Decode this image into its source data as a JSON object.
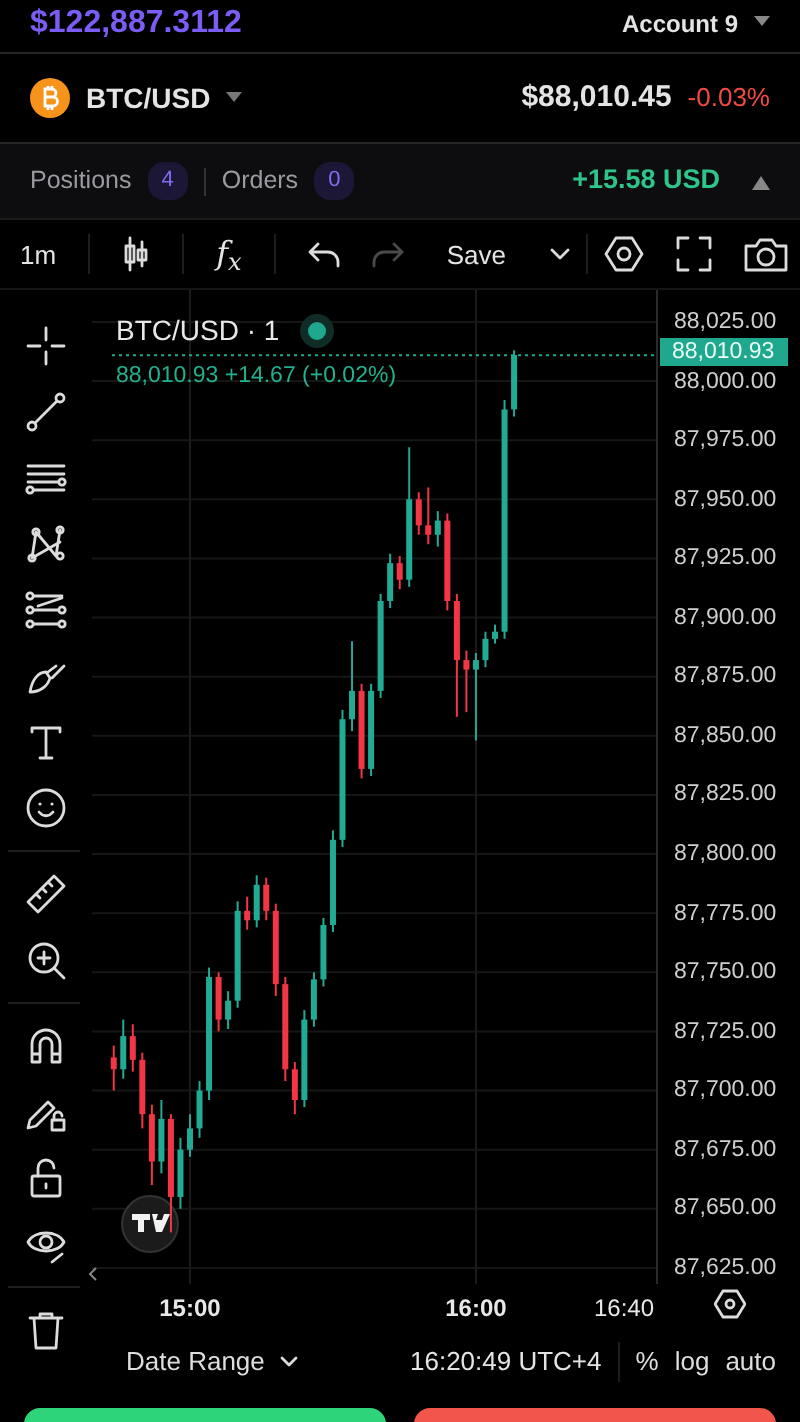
{
  "header": {
    "balance": "$122,887.3112",
    "account": "Account 9"
  },
  "ticker": {
    "symbol": "BTC/USD",
    "price": "$88,010.45",
    "change": "-0.03%"
  },
  "tabs": [
    {
      "label": "Positions",
      "count": "4"
    },
    {
      "label": "Orders",
      "count": "0"
    }
  ],
  "pnl": "+15.58 USD",
  "toolbar": {
    "interval": "1m",
    "indicators": "f$_{x}$",
    "save": "Save"
  },
  "tool_groups": [
    [
      {
        "kind": "crosshair"
      },
      {
        "kind": "trend-line"
      },
      {
        "kind": "horizontal-lines"
      },
      {
        "kind": "pattern"
      },
      {
        "kind": "channel"
      },
      {
        "kind": "brush"
      },
      {
        "kind": "text"
      },
      {
        "kind": "emoji"
      }
    ],
    [
      {
        "kind": "ruler"
      },
      {
        "kind": "zoom-in"
      }
    ],
    [
      {
        "kind": "magnet"
      },
      {
        "kind": "pencil-lock"
      },
      {
        "kind": "lock-open"
      },
      {
        "kind": "eye"
      }
    ],
    [
      {
        "kind": "trash"
      }
    ]
  ],
  "chart": {
    "chart_data": {
      "type": "candlestick",
      "xlim": [
        879.44,
        997.78
      ],
      "ylim": [
        87618.2,
        88038.5
      ],
      "grid": true,
      "ref_lines": [
        {
          "axis": "y",
          "value": 88010.93,
          "color": "#1fa88e"
        }
      ],
      "xticks": [
        {
          "value": 900,
          "label": "15:00"
        },
        {
          "value": 960,
          "label": "16:00"
        }
      ],
      "yticks": [
        {
          "value": 88025,
          "label": "88,025.00"
        },
        {
          "value": 88000,
          "label": "88,000.00"
        },
        {
          "value": 87975,
          "label": "87,975.00"
        },
        {
          "value": 87950,
          "label": "87,950.00"
        },
        {
          "value": 87925,
          "label": "87,925.00"
        },
        {
          "value": 87900,
          "label": "87,900.00"
        },
        {
          "value": 87875,
          "label": "87,875.00"
        },
        {
          "value": 87850,
          "label": "87,850.00"
        },
        {
          "value": 87825,
          "label": "87,825.00"
        },
        {
          "value": 87800,
          "label": "87,800.00"
        },
        {
          "value": 87775,
          "label": "87,775.00"
        },
        {
          "value": 87750,
          "label": "87,750.00"
        },
        {
          "value": 87725,
          "label": "87,725.00"
        },
        {
          "value": 87700,
          "label": "87,700.00"
        },
        {
          "value": 87675,
          "label": "87,675.00"
        },
        {
          "value": 87650,
          "label": "87,650.00"
        },
        {
          "value": 87625,
          "label": "87,625.00"
        }
      ],
      "x": [
        884,
        886,
        888,
        890,
        892,
        894,
        896,
        898,
        900,
        902,
        904,
        906,
        908,
        910,
        912,
        914,
        916,
        918,
        920,
        922,
        924,
        926,
        928,
        930,
        932,
        934,
        936,
        938,
        940,
        942,
        944,
        946,
        948,
        950,
        952,
        954,
        956,
        958,
        960,
        962,
        964,
        966,
        968
      ],
      "ohlc": [
        [
          87714,
          87719,
          87700,
          87709
        ],
        [
          87709,
          87730,
          87705,
          87723
        ],
        [
          87723,
          87728,
          87708,
          87713
        ],
        [
          87713,
          87716,
          87684,
          87690
        ],
        [
          87690,
          87694,
          87660,
          87670
        ],
        [
          87670,
          87696,
          87665,
          87688
        ],
        [
          87688,
          87690,
          87640,
          87655
        ],
        [
          87655,
          87680,
          87650,
          87675
        ],
        [
          87675,
          87690,
          87672,
          87684
        ],
        [
          87684,
          87704,
          87680,
          87700
        ],
        [
          87700,
          87752,
          87696,
          87748
        ],
        [
          87748,
          87750,
          87725,
          87730
        ],
        [
          87730,
          87742,
          87726,
          87738
        ],
        [
          87738,
          87780,
          87735,
          87776
        ],
        [
          87776,
          87782,
          87768,
          87772
        ],
        [
          87772,
          87791,
          87769,
          87787
        ],
        [
          87787,
          87790,
          87772,
          87776
        ],
        [
          87776,
          87779,
          87740,
          87745
        ],
        [
          87745,
          87748,
          87704,
          87709
        ],
        [
          87709,
          87712,
          87690,
          87696
        ],
        [
          87696,
          87734,
          87693,
          87730
        ],
        [
          87730,
          87750,
          87727,
          87747
        ],
        [
          87747,
          87773,
          87744,
          87770
        ],
        [
          87770,
          87810,
          87767,
          87806
        ],
        [
          87806,
          87861,
          87803,
          87857
        ],
        [
          87857,
          87890,
          87852,
          87869
        ],
        [
          87869,
          87872,
          87832,
          87836
        ],
        [
          87836,
          87872,
          87833,
          87869
        ],
        [
          87869,
          87910,
          87866,
          87907
        ],
        [
          87907,
          87927,
          87904,
          87923
        ],
        [
          87923,
          87926,
          87912,
          87916
        ],
        [
          87916,
          87972,
          87913,
          87950
        ],
        [
          87950,
          87953,
          87935,
          87939
        ],
        [
          87939,
          87955,
          87931,
          87935
        ],
        [
          87935,
          87945,
          87930,
          87941
        ],
        [
          87941,
          87944,
          87903,
          87907
        ],
        [
          87907,
          87910,
          87858,
          87882
        ],
        [
          87882,
          87886,
          87860,
          87878
        ],
        [
          87878,
          87885,
          87848,
          87882
        ],
        [
          87882,
          87894,
          87879,
          87891
        ],
        [
          87891,
          87897,
          87889,
          87894
        ],
        [
          87894,
          87992,
          87891,
          87988
        ],
        [
          87988,
          88013,
          87985,
          88011
        ]
      ]
    },
    "legend_title": "BTC/USD · 1",
    "legend_values": "88,010.93 +14.67 (+0.02%)",
    "last_price": "88,010.93",
    "xticks_bold": true,
    "edge_time_label": {
      "label": "16:40",
      "bold": false
    }
  },
  "bottom_bar": {
    "date_range": "Date Range",
    "clock": "16:20:49 UTC+4",
    "options": [
      "%",
      "log",
      "auto"
    ]
  },
  "action_buttons": [
    {
      "color": "#2ed47a"
    },
    {
      "color": "#f2554a"
    }
  ]
}
